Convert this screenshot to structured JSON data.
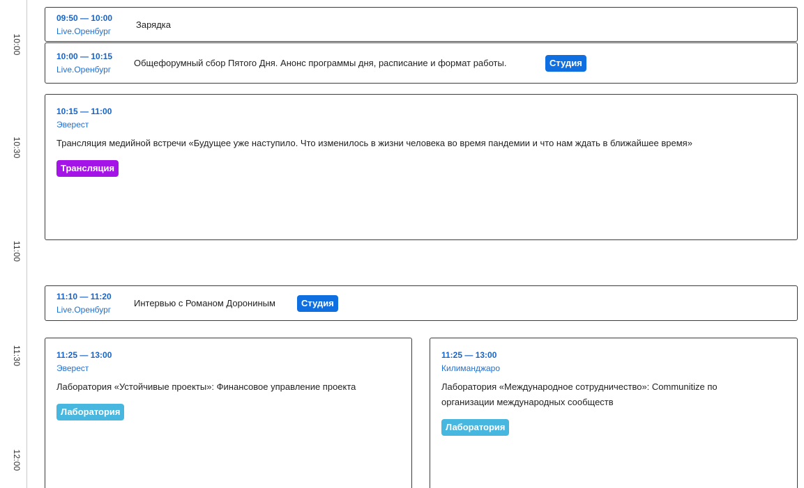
{
  "timeline": {
    "labels": [
      "10:00",
      "10:30",
      "11:00",
      "11:30",
      "12:00"
    ]
  },
  "tag_colors": {
    "studio": "#0f6fe0",
    "broadcast": "#a514e6",
    "lab": "#48b7df"
  },
  "events": [
    {
      "time": "09:50 — 10:00",
      "location": "Live.Оренбург",
      "title": "Зарядка"
    },
    {
      "time": "10:00 — 10:15",
      "location": "Live.Оренбург",
      "title": "Общефорумный сбор Пятого Дня. Анонс программы дня, расписание и формат работы.",
      "tag": "Студия"
    },
    {
      "time": "10:15 — 11:00",
      "location": "Эверест",
      "title": "Трансляция медийной встречи «Будущее уже наступило. Что изменилось в жизни человека во время пандемии и что нам ждать в ближайшее время»",
      "tag": "Трансляция"
    },
    {
      "time": "11:10 — 11:20",
      "location": "Live.Оренбург",
      "title": "Интервью с Романом Дорониным",
      "tag": "Студия"
    },
    {
      "time": "11:25 — 13:00",
      "location": "Эверест",
      "title": "Лаборатория «Устойчивые проекты»: Финансовое управление проекта",
      "tag": "Лаборатория"
    },
    {
      "time": "11:25 — 13:00",
      "location": "Килиманджаро",
      "title": "Лаборатория «Международное сотрудничество»: Communitize по организации международных сообществ",
      "tag": "Лаборатория"
    }
  ]
}
